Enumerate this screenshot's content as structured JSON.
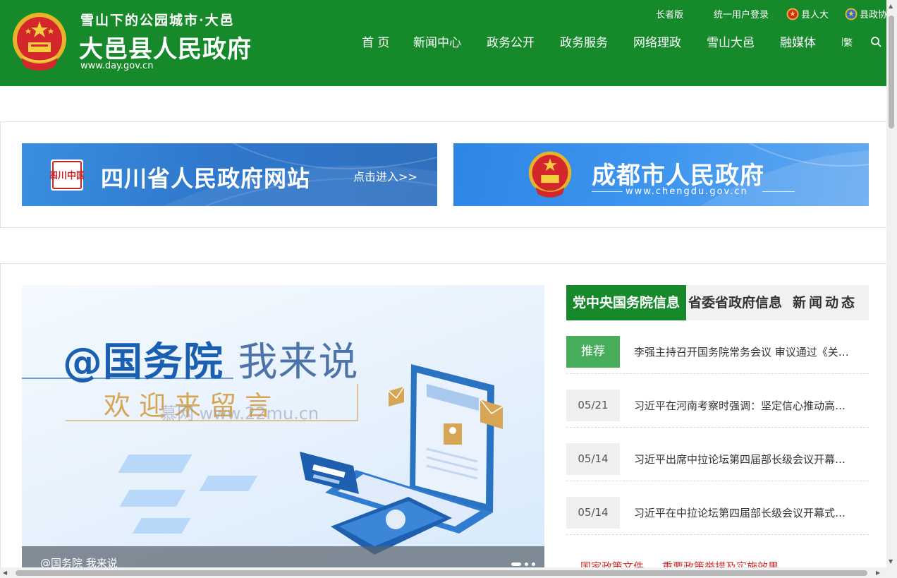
{
  "header": {
    "tagline": "雪山下的公园城市·大邑",
    "site_title": "大邑县人民政府",
    "domain": "www.day.gov.cn",
    "top_links": {
      "elder": "长者版",
      "login": "统一用户登录",
      "congress": "县人大",
      "cppcc": "县政协"
    },
    "nav": [
      "首 页",
      "新闻中心",
      "政务公开",
      "政务服务",
      "网络理政",
      "雪山大邑",
      "融媒体"
    ],
    "lang_toggle": "繁",
    "brand_color": "#168a2b"
  },
  "banners": {
    "sichuan": {
      "title": "四川省人民政府网站",
      "enter": "点击进入>>",
      "seal_text": "四川中国"
    },
    "chengdu": {
      "title": "成都市人民政府",
      "domain": "www.chengdu.gov.cn"
    }
  },
  "carousel": {
    "headline_main": "@国务院",
    "headline_thin": "我来说",
    "subline": "欢迎来留言",
    "watermark": "慕网 www.22mu.cn",
    "caption": "@国务院 我来说"
  },
  "tabs": {
    "central": "党中央国务院信息",
    "provincial": "省委省政府信息",
    "news": "新闻动态"
  },
  "news": [
    {
      "date": "推荐",
      "title": "李强主持召开国务院常务会议 审议通过《关于加快发展服务业的意见》",
      "featured": true
    },
    {
      "date": "05/21",
      "title": "习近平在河南考察时强调：坚定信心推动高质量发展",
      "featured": false
    },
    {
      "date": "05/14",
      "title": "习近平出席中拉论坛第四届部长级会议开幕式并发表主旨讲话",
      "featured": false
    },
    {
      "date": "05/14",
      "title": "习近平在中拉论坛第四届部长级会议开幕式上的主旨讲话",
      "featured": false
    }
  ],
  "policy_links": [
    "国家政策文件",
    "重要政策举措及实施效果"
  ],
  "icons": {
    "emblem": "national-emblem-icon",
    "search": "search-icon",
    "mini_emblem": "mini-emblem-icon"
  }
}
